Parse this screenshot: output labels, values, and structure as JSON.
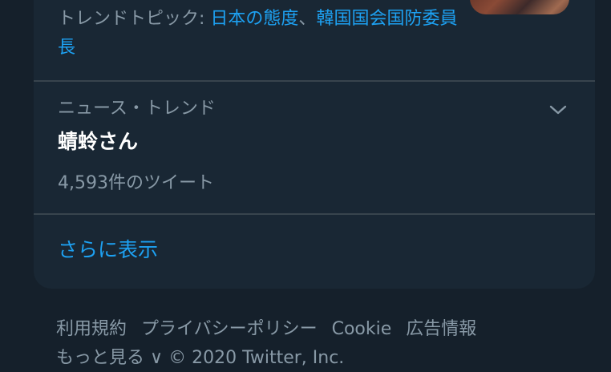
{
  "trends": {
    "previous_item": {
      "topics_prefix": "トレンドトピック: ",
      "topic_1": "日本の態度",
      "separator": "、",
      "topic_2": "韓国国会国防委員長"
    },
    "item": {
      "context": "ニュース・トレンド",
      "title": "蜻蛉さん",
      "tweet_count": "4,593件のツイート",
      "more_icon": "chevron-down-icon"
    },
    "show_more_label": "さらに表示"
  },
  "footer": {
    "links": [
      "利用規約",
      "プライバシーポリシー",
      "Cookie",
      "広告情報"
    ],
    "second_row": "もっと見る ∨  © 2020 Twitter, Inc."
  },
  "colors": {
    "background": "#15202b",
    "panel": "#192734",
    "accent": "#1da1f2",
    "secondary_text": "#8899a6",
    "divider": "#38444d"
  }
}
